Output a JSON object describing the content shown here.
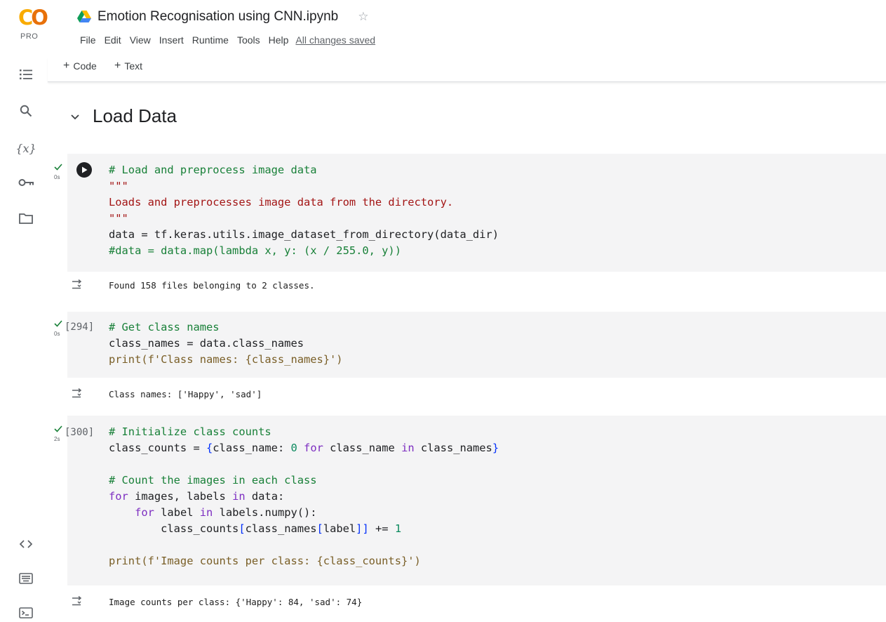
{
  "app": {
    "logo_text": "CO",
    "logo_badge": "PRO",
    "notebook_title": "Emotion Recognisation using CNN.ipynb",
    "save_status": "All changes saved"
  },
  "menu": [
    "File",
    "Edit",
    "View",
    "Insert",
    "Runtime",
    "Tools",
    "Help"
  ],
  "toolbar": {
    "add_code": "Code",
    "add_text": "Text"
  },
  "sidebar_icons": [
    "table-of-contents-icon",
    "search-icon",
    "variables-icon",
    "secrets-key-icon",
    "files-folder-icon",
    "code-snippets-icon",
    "command-palette-icon",
    "terminal-icon"
  ],
  "section": {
    "title": "Load Data"
  },
  "cells": [
    {
      "exec_count": "",
      "exec_time": "0s",
      "code": [
        "# Load and preprocess image data",
        "\"\"\"",
        "Loads and preprocesses image data from the directory.",
        "\"\"\"",
        "data = tf.keras.utils.image_dataset_from_directory(data_dir)",
        "#data = data.map(lambda x, y: (x / 255.0, y))"
      ],
      "output": "Found 158 files belonging to 2 classes."
    },
    {
      "exec_count": "[294]",
      "exec_time": "0s",
      "code": [
        "# Get class names",
        "class_names = data.class_names",
        "print(f'Class names: {class_names}')"
      ],
      "output": "Class names: ['Happy', 'sad']"
    },
    {
      "exec_count": "[300]",
      "exec_time": "2s",
      "code": [
        "# Initialize class counts",
        "class_counts = {class_name: 0 for class_name in class_names}",
        "",
        "# Count the images in each class",
        "for images, labels in data:",
        "    for label in labels.numpy():",
        "        class_counts[class_names[label]] += 1",
        "",
        "print(f'Image counts per class: {class_counts}')"
      ],
      "output": "Image counts per class: {'Happy': 84, 'sad': 74}"
    }
  ],
  "colors": {
    "comment": "#188038",
    "string": "#a31515",
    "keyword": "#7d2ec1",
    "number": "#0b8a5e",
    "bracket": "#0431fa",
    "cell_background": "#f4f4f5",
    "success_check": "#188038"
  }
}
